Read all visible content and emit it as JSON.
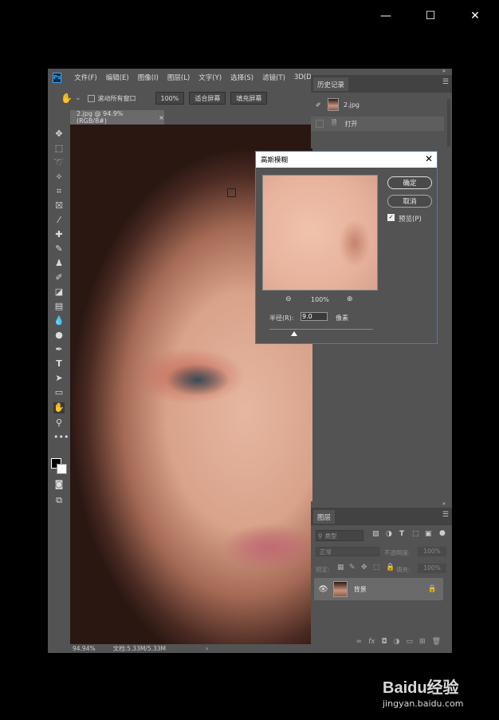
{
  "window": {
    "minimize": "—",
    "maximize": "☐",
    "close": "✕"
  },
  "app": {
    "logo": "Ps",
    "menus": [
      "文件(F)",
      "编辑(E)",
      "图像(I)",
      "图层(L)",
      "文字(Y)",
      "选择(S)",
      "滤镜(T)",
      "3D(D)"
    ],
    "options": {
      "scroll_all": "滚动所有窗口",
      "zoom": "100%",
      "fit_screen": "适合屏幕",
      "fill_screen": "填充屏幕"
    },
    "doc_tab": {
      "title": "2.jpg @ 94.9%(RGB/8#)",
      "close": "×"
    },
    "status": {
      "zoom": "94.94%",
      "doc": "文档:5.33M/5.33M",
      "arrow": "›"
    }
  },
  "history": {
    "tab": "历史记录",
    "snapshot": "2.jpg",
    "items": [
      {
        "label": "打开"
      }
    ]
  },
  "dialog": {
    "title": "高斯模糊",
    "close": "✕",
    "ok": "确定",
    "cancel": "取消",
    "preview_label": "预览(P)",
    "preview_checked": true,
    "zoom": "100%",
    "radius_label": "半径(R):",
    "radius_value": "9.0",
    "unit": "像素",
    "radius_fraction": 0.24
  },
  "layers": {
    "tab": "图层",
    "filter_kind": "类型",
    "blend_mode": "正常",
    "opacity_label": "不透明度:",
    "opacity_value": "100%",
    "lock_label": "锁定:",
    "fill_label": "填充:",
    "fill_value": "100%",
    "layer_name": "背景"
  },
  "watermark": {
    "brand": "Baidu经验",
    "url": "jingyan.baidu.com"
  },
  "colors": {
    "accent": "#31a8ff",
    "panel": "#535353",
    "dialog_border": "#3d7bd8"
  }
}
